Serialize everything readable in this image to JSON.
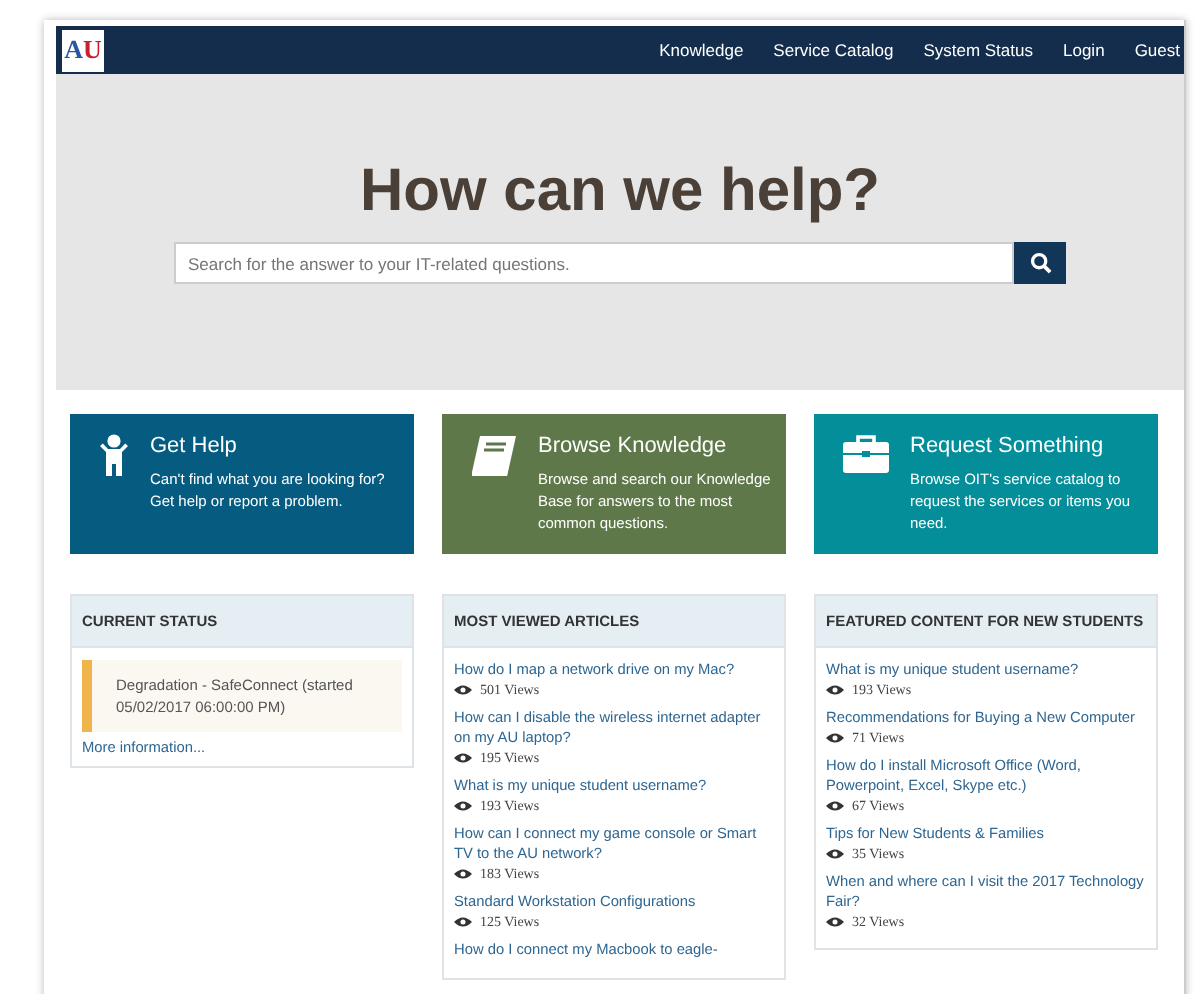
{
  "logo": {
    "letters": [
      "A",
      "U"
    ]
  },
  "nav": [
    {
      "label": "Knowledge"
    },
    {
      "label": "Service Catalog"
    },
    {
      "label": "System Status"
    },
    {
      "label": "Login"
    },
    {
      "label": "Guest"
    }
  ],
  "hero": {
    "title": "How can we help?",
    "search": {
      "placeholder": "Search for the answer to your IT-related questions."
    }
  },
  "tiles": [
    {
      "kind": "help",
      "title": "Get Help",
      "text": "Can't find what you are looking for? Get help or report a problem.",
      "color": "#065b80"
    },
    {
      "kind": "book",
      "title": "Browse Knowledge",
      "text": "Browse and search our Knowledge Base for answers to the most common questions.",
      "color": "#5e7849"
    },
    {
      "kind": "briefcase",
      "title": "Request Something",
      "text": "Browse OIT's service catalog to request the services or items you need.",
      "color": "#038e99"
    }
  ],
  "status_panel": {
    "title": "CURRENT STATUS",
    "alerts": [
      {
        "text": "Degradation - SafeConnect (started 05/02/2017 06:00:00 PM)",
        "color": "#f0b44c"
      }
    ],
    "link": "More information..."
  },
  "panels": [
    {
      "title": "MOST VIEWED ARTICLES",
      "articles": [
        {
          "title": "How do I map a network drive on my Mac?",
          "views": "501 Views"
        },
        {
          "title": "How can I disable the wireless internet adapter on my AU laptop?",
          "views": "195 Views"
        },
        {
          "title": "What is my unique student username?",
          "views": "193 Views"
        },
        {
          "title": "How can I connect my game console or Smart TV to the AU network?",
          "views": "183 Views"
        },
        {
          "title": "Standard Workstation Configurations",
          "views": "125 Views"
        },
        {
          "title": "How do I connect my Macbook to eagle-"
        }
      ]
    },
    {
      "title": "FEATURED CONTENT FOR NEW STUDENTS",
      "articles": [
        {
          "title": "What is my unique student username?",
          "views": "193 Views"
        },
        {
          "title": "Recommendations for Buying a New Computer",
          "views": "71 Views"
        },
        {
          "title": "How do I install Microsoft Office (Word, Powerpoint, Excel, Skype etc.)",
          "views": "67 Views"
        },
        {
          "title": "Tips for New Students & Families",
          "views": "35 Views"
        },
        {
          "title": "When and where can I visit the 2017 Technology Fair?",
          "views": "32 Views"
        }
      ]
    }
  ]
}
